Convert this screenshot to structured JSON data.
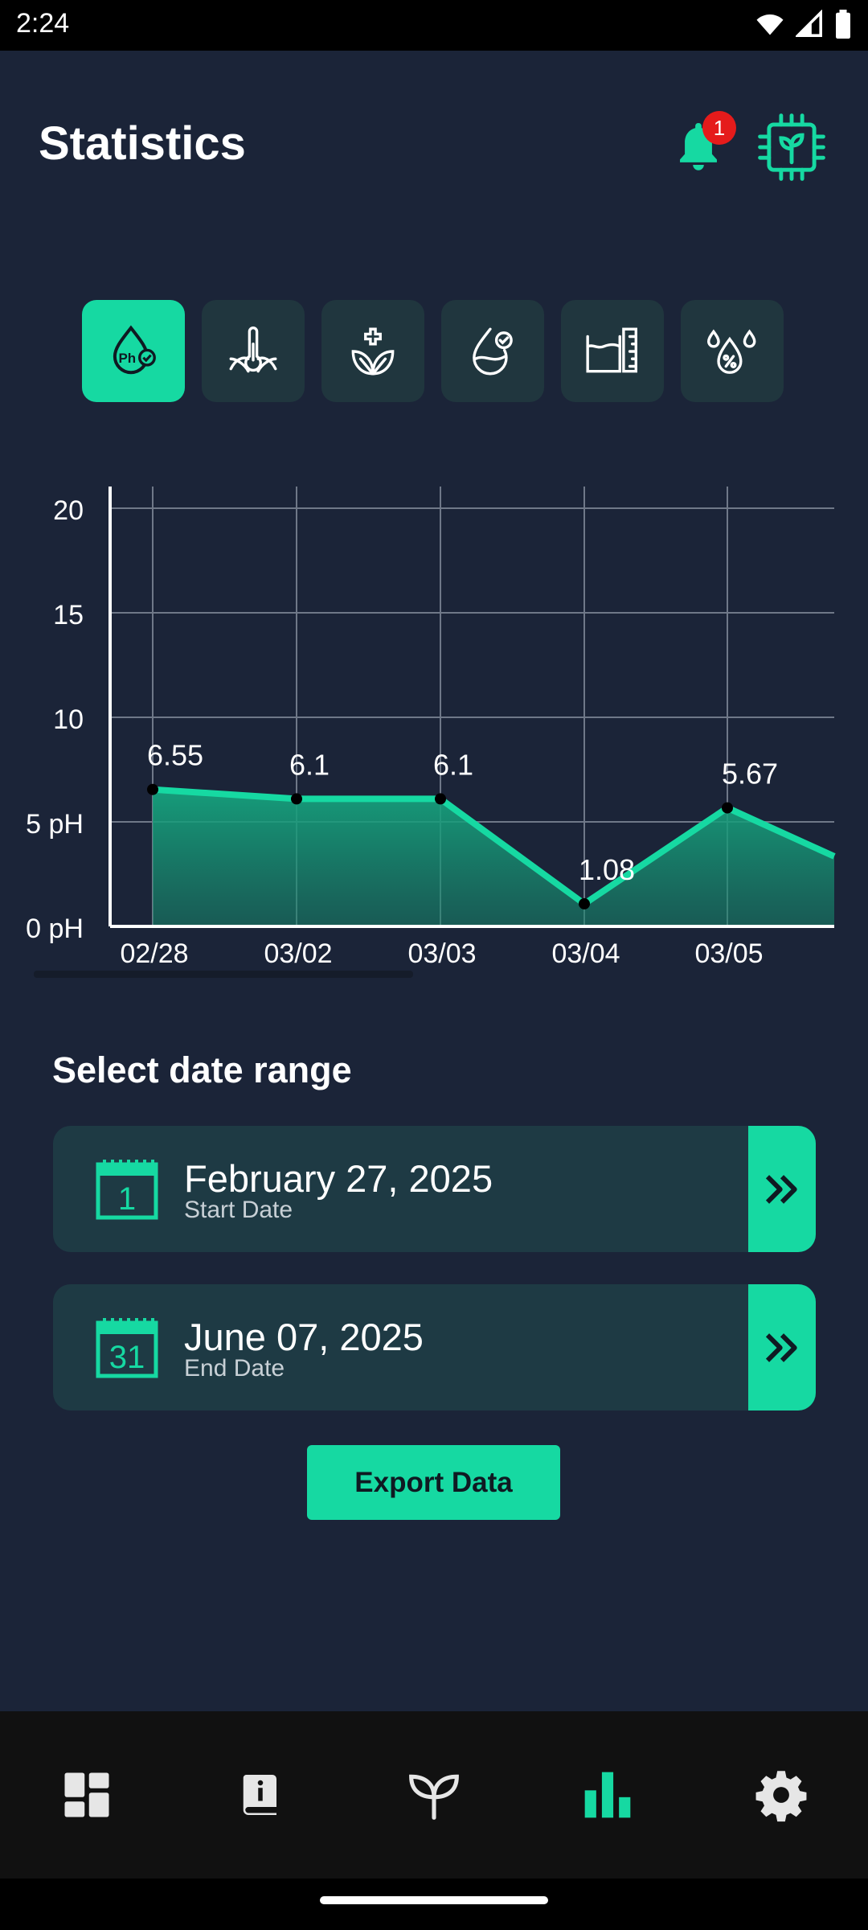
{
  "status": {
    "time": "2:24"
  },
  "header": {
    "title": "Statistics",
    "notification_count": "1"
  },
  "colors": {
    "accent": "#16d9a2",
    "background": "#1b2438",
    "card": "#1e3a44",
    "alert": "#e51b1b"
  },
  "sensors": [
    {
      "icon": "ph-icon",
      "active": true
    },
    {
      "icon": "temperature-plant-icon",
      "active": false
    },
    {
      "icon": "plant-health-icon",
      "active": false
    },
    {
      "icon": "water-quality-icon",
      "active": false
    },
    {
      "icon": "water-level-icon",
      "active": false
    },
    {
      "icon": "humidity-drops-icon",
      "active": false
    }
  ],
  "chart_data": {
    "type": "area",
    "categories": [
      "02/28",
      "03/02",
      "03/03",
      "03/04",
      "03/05"
    ],
    "values": [
      6.55,
      6.1,
      6.1,
      1.08,
      5.67
    ],
    "data_labels": [
      "6.55",
      "6.1",
      "6.1",
      "1.08",
      "5.67"
    ],
    "yticks": [
      "0 pH",
      "5 pH",
      "10",
      "15",
      "20"
    ],
    "ylim": [
      0,
      20
    ],
    "grid": true,
    "color": "#16d9a2"
  },
  "date_range": {
    "title": "Select date range",
    "start": {
      "value": "February 27, 2025",
      "label": "Start Date",
      "calendar_day": "1"
    },
    "end": {
      "value": "June 07, 2025",
      "label": "End Date",
      "calendar_day": "31"
    }
  },
  "export_label": "Export Data",
  "nav": [
    {
      "icon": "dashboard-icon",
      "active": false
    },
    {
      "icon": "info-book-icon",
      "active": false
    },
    {
      "icon": "plant-sprout-icon",
      "active": false
    },
    {
      "icon": "statistics-bar-icon",
      "active": true
    },
    {
      "icon": "settings-gear-icon",
      "active": false
    }
  ]
}
